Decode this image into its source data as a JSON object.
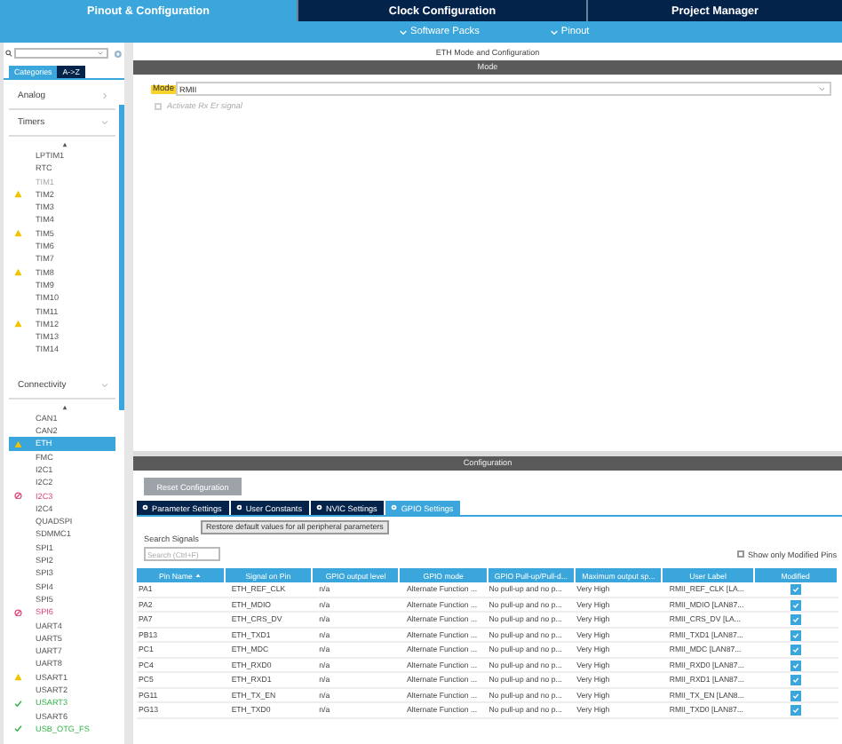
{
  "top_tabs": [
    {
      "label": "Pinout & Configuration",
      "selected": true
    },
    {
      "label": "Clock Configuration",
      "selected": false
    },
    {
      "label": "Project Manager",
      "selected": false
    }
  ],
  "sub_menu": [
    "Software Packs",
    "Pinout"
  ],
  "sidebar": {
    "view_tabs": [
      {
        "label": "Categories",
        "selected": true
      },
      {
        "label": "A->Z",
        "selected": false
      }
    ],
    "categories": [
      {
        "name": "Analog",
        "expanded": false
      },
      {
        "name": "Timers",
        "expanded": true,
        "items": [
          {
            "label": "LPTIM1",
            "kind": "plain",
            "disabled": false,
            "selected": false
          },
          {
            "label": "RTC",
            "kind": "plain",
            "disabled": false,
            "selected": false
          },
          {
            "label": "TIM1",
            "kind": "plain",
            "disabled": true,
            "selected": false
          },
          {
            "label": "TIM2",
            "kind": "warning",
            "disabled": false,
            "selected": false
          },
          {
            "label": "TIM3",
            "kind": "plain",
            "disabled": false,
            "selected": false
          },
          {
            "label": "TIM4",
            "kind": "plain",
            "disabled": false,
            "selected": false
          },
          {
            "label": "TIM5",
            "kind": "warning",
            "disabled": false,
            "selected": false
          },
          {
            "label": "TIM6",
            "kind": "plain",
            "disabled": false,
            "selected": false
          },
          {
            "label": "TIM7",
            "kind": "plain",
            "disabled": false,
            "selected": false
          },
          {
            "label": "TIM8",
            "kind": "warning",
            "disabled": false,
            "selected": false
          },
          {
            "label": "TIM9",
            "kind": "plain",
            "disabled": false,
            "selected": false
          },
          {
            "label": "TIM10",
            "kind": "plain",
            "disabled": false,
            "selected": false
          },
          {
            "label": "TIM11",
            "kind": "plain",
            "disabled": false,
            "selected": false
          },
          {
            "label": "TIM12",
            "kind": "warning",
            "disabled": false,
            "selected": false
          },
          {
            "label": "TIM13",
            "kind": "plain",
            "disabled": false,
            "selected": false
          },
          {
            "label": "TIM14",
            "kind": "plain",
            "disabled": false,
            "selected": false
          }
        ]
      },
      {
        "name": "Connectivity",
        "expanded": true,
        "items": [
          {
            "label": "CAN1",
            "kind": "plain",
            "disabled": false,
            "selected": false
          },
          {
            "label": "CAN2",
            "kind": "plain",
            "disabled": false,
            "selected": false
          },
          {
            "label": "ETH",
            "kind": "warning",
            "disabled": false,
            "selected": true
          },
          {
            "label": "FMC",
            "kind": "plain",
            "disabled": false,
            "selected": false
          },
          {
            "label": "I2C1",
            "kind": "plain",
            "disabled": false,
            "selected": false
          },
          {
            "label": "I2C2",
            "kind": "plain",
            "disabled": false,
            "selected": false
          },
          {
            "label": "I2C3",
            "kind": "error",
            "disabled": false,
            "selected": false
          },
          {
            "label": "I2C4",
            "kind": "plain",
            "disabled": false,
            "selected": false
          },
          {
            "label": "QUADSPI",
            "kind": "plain",
            "disabled": false,
            "selected": false
          },
          {
            "label": "SDMMC1",
            "kind": "plain",
            "disabled": false,
            "selected": false
          },
          {
            "label": "SPI1",
            "kind": "plain",
            "disabled": false,
            "selected": false
          },
          {
            "label": "SPI2",
            "kind": "plain",
            "disabled": false,
            "selected": false
          },
          {
            "label": "SPI3",
            "kind": "plain",
            "disabled": false,
            "selected": false
          },
          {
            "label": "SPI4",
            "kind": "plain",
            "disabled": false,
            "selected": false
          },
          {
            "label": "SPI5",
            "kind": "plain",
            "disabled": false,
            "selected": false
          },
          {
            "label": "SPI6",
            "kind": "error",
            "disabled": false,
            "selected": false
          },
          {
            "label": "UART4",
            "kind": "plain",
            "disabled": false,
            "selected": false
          },
          {
            "label": "UART5",
            "kind": "plain",
            "disabled": false,
            "selected": false
          },
          {
            "label": "UART7",
            "kind": "plain",
            "disabled": false,
            "selected": false
          },
          {
            "label": "UART8",
            "kind": "plain",
            "disabled": false,
            "selected": false
          },
          {
            "label": "USART1",
            "kind": "warning",
            "disabled": false,
            "selected": false
          },
          {
            "label": "USART2",
            "kind": "plain",
            "disabled": false,
            "selected": false
          },
          {
            "label": "USART3",
            "kind": "ok",
            "disabled": false,
            "selected": false
          },
          {
            "label": "USART6",
            "kind": "plain",
            "disabled": false,
            "selected": false
          },
          {
            "label": "USB_OTG_FS",
            "kind": "ok",
            "disabled": false,
            "selected": false
          }
        ]
      }
    ]
  },
  "main": {
    "title": "ETH Mode and Configuration",
    "mode_section": {
      "heading": "Mode",
      "mode_label": "Mode",
      "mode_value": "RMII",
      "options": [
        {
          "label": "Activate Rx Er signal",
          "checked": false,
          "disabled": true
        }
      ]
    },
    "config_section": {
      "heading": "Configuration",
      "reset_button": {
        "label": "Reset Configuration",
        "disabled": true
      },
      "tabs": [
        {
          "label": "Parameter Settings",
          "selected": false
        },
        {
          "label": "User Constants",
          "selected": false
        },
        {
          "label": "NVIC Settings",
          "selected": false
        },
        {
          "label": "GPIO Settings",
          "selected": true
        }
      ],
      "tooltip": "Restore default values for all peripheral parameters",
      "search_label": "Search Signals",
      "search_placeholder": "Search (Ctrl+F)",
      "modified_filter": {
        "label": "Show only Modified Pins",
        "checked": false
      },
      "table": {
        "columns": [
          "Pin Name",
          "Signal on Pin",
          "GPIO output level",
          "GPIO mode",
          "GPIO Pull-up/Pull-d...",
          "Maximum output sp...",
          "User Label",
          "Modified"
        ],
        "rows": [
          {
            "cells": [
              "PA1",
              "ETH_REF_CLK",
              "n/a",
              "Alternate Function ...",
              "No pull-up and no p...",
              "Very High",
              "RMII_REF_CLK [LA..."
            ],
            "modified": true
          },
          {
            "cells": [
              "PA2",
              "ETH_MDIO",
              "n/a",
              "Alternate Function ...",
              "No pull-up and no p...",
              "Very High",
              "RMII_MDIO [LAN87..."
            ],
            "modified": true
          },
          {
            "cells": [
              "PA7",
              "ETH_CRS_DV",
              "n/a",
              "Alternate Function ...",
              "No pull-up and no p...",
              "Very High",
              "RMII_CRS_DV [LA..."
            ],
            "modified": true
          },
          {
            "cells": [
              "PB13",
              "ETH_TXD1",
              "n/a",
              "Alternate Function ...",
              "No pull-up and no p...",
              "Very High",
              "RMII_TXD1 [LAN87..."
            ],
            "modified": true
          },
          {
            "cells": [
              "PC1",
              "ETH_MDC",
              "n/a",
              "Alternate Function ...",
              "No pull-up and no p...",
              "Very High",
              "RMII_MDC [LAN87..."
            ],
            "modified": true
          },
          {
            "cells": [
              "PC4",
              "ETH_RXD0",
              "n/a",
              "Alternate Function ...",
              "No pull-up and no p...",
              "Very High",
              "RMII_RXD0 [LAN87..."
            ],
            "modified": true
          },
          {
            "cells": [
              "PC5",
              "ETH_RXD1",
              "n/a",
              "Alternate Function ...",
              "No pull-up and no p...",
              "Very High",
              "RMII_RXD1 [LAN87..."
            ],
            "modified": true
          },
          {
            "cells": [
              "PG11",
              "ETH_TX_EN",
              "n/a",
              "Alternate Function ...",
              "No pull-up and no p...",
              "Very High",
              "RMII_TX_EN [LAN8..."
            ],
            "modified": true
          },
          {
            "cells": [
              "PG13",
              "ETH_TXD0",
              "n/a",
              "Alternate Function ...",
              "No pull-up and no p...",
              "Very High",
              "RMII_TXD0 [LAN87..."
            ],
            "modified": true
          }
        ]
      }
    }
  }
}
